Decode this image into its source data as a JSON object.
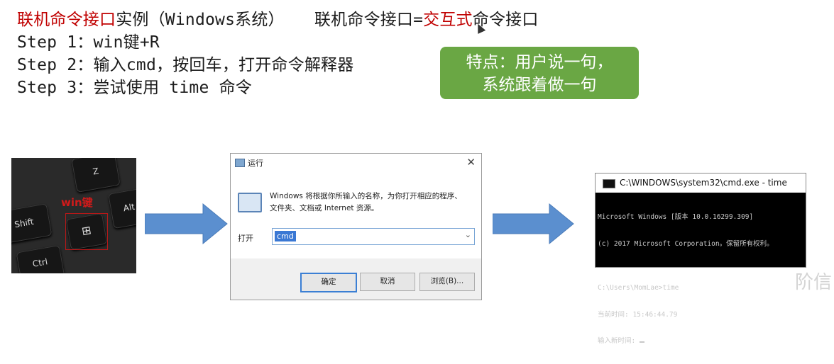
{
  "heading": {
    "part1_red": "联机命令接口",
    "part2": "实例（Windows系统）",
    "part3": "联机命令接口=",
    "part4_red": "交互式",
    "part5": "命令接口"
  },
  "steps": [
    "Step 1：win键+R",
    "Step 2：输入cmd，按回车，打开命令解释器",
    "Step 3：尝试使用 time 命令"
  ],
  "callout": {
    "line1": "特点：用户说一句，",
    "line2": "系统跟着做一句"
  },
  "keyboard": {
    "win_label": "win键",
    "keys": [
      "Z",
      "Shift",
      "Ctrl",
      "Alt"
    ]
  },
  "run_dialog": {
    "title": "运行",
    "close": "✕",
    "description_line1": "Windows 将根据你所输入的名称，为你打开相应的程序、",
    "description_line2": "文件夹、文档或 Internet 资源。",
    "open_label": "打开",
    "input_value": "cmd",
    "ok": "确定",
    "cancel": "取消",
    "browse": "浏览(B)..."
  },
  "cmd_window": {
    "title": "C:\\WINDOWS\\system32\\cmd.exe - time",
    "lines": [
      "Microsoft Windows [版本 10.0.16299.309]",
      "(c) 2017 Microsoft Corporation。保留所有权利。",
      "",
      "C:\\Users\\MomLae>time",
      "当前时间: 15:46:44.79",
      "输入新时间: "
    ]
  },
  "watermark": "阶信",
  "colors": {
    "accent_red": "#c00000",
    "callout_green": "#6aa744",
    "arrow_blue": "#5b8fcf"
  }
}
